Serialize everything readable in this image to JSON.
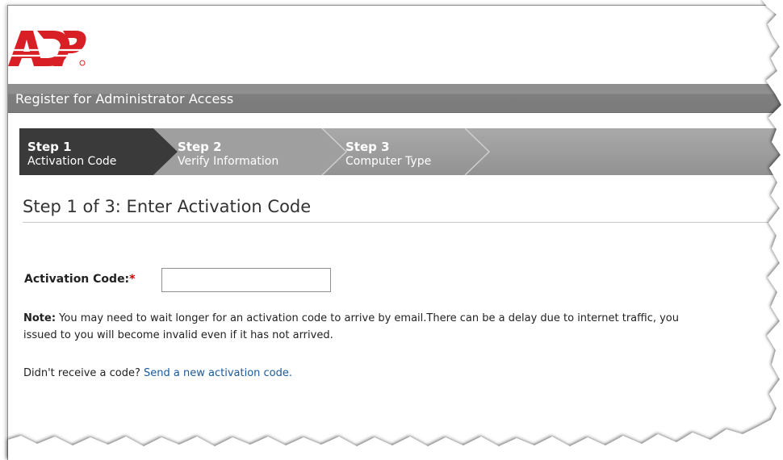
{
  "brand": {
    "logo_text": "ADP"
  },
  "header": {
    "title": "Register for Administrator Access"
  },
  "steps": [
    {
      "number": "Step 1",
      "name": "Activation Code",
      "active": true
    },
    {
      "number": "Step 2",
      "name": "Verify Information",
      "active": false
    },
    {
      "number": "Step 3",
      "name": "Computer Type",
      "active": false
    }
  ],
  "main": {
    "heading": "Step 1 of 3: Enter Activation Code",
    "activation_label": "Activation Code:",
    "required_mark": "*",
    "activation_value": "",
    "note_label": "Note:",
    "note_text": " You may need to wait longer for an activation code to arrive by email.There can be a delay due to internet traffic, you",
    "note_text_2": "issued to you will become invalid even if it has not arrived.",
    "resend_prompt": "Didn't receive a code? ",
    "resend_link": "Send a new activation code."
  },
  "colors": {
    "brand_red": "#d91f26",
    "title_bar": "#7e7e7e",
    "step_active": "#3a3a3a",
    "step_inactive": "#9e9e9e",
    "link": "#1a5aa0",
    "required": "#cc0000"
  }
}
